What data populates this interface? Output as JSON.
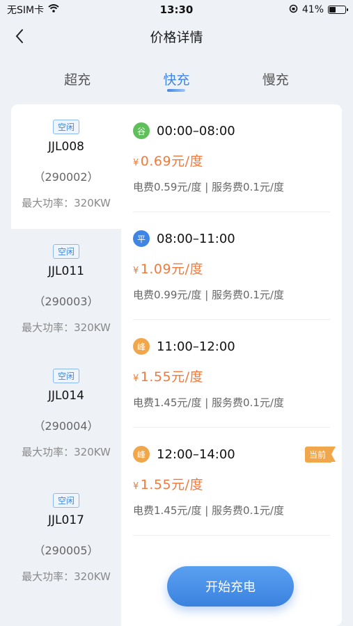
{
  "status_bar": {
    "carrier": "无SIM卡",
    "time": "13:30",
    "battery": "41%",
    "battery_level": 0.41
  },
  "nav": {
    "title": "价格详情"
  },
  "tabs": [
    {
      "label": "超充",
      "active": false
    },
    {
      "label": "快充",
      "active": true
    },
    {
      "label": "慢充",
      "active": false
    }
  ],
  "piles": [
    {
      "badge": "空闲",
      "name": "JJL008",
      "code": "（290002）",
      "power": "最大功率：320KW"
    },
    {
      "badge": "空闲",
      "name": "JJL011",
      "code": "（290003）",
      "power": "最大功率：320KW"
    },
    {
      "badge": "空闲",
      "name": "JJL014",
      "code": "（290004）",
      "power": "最大功率：320KW"
    },
    {
      "badge": "空闲",
      "name": "JJL017",
      "code": "（290005）",
      "power": "最大功率：320KW"
    }
  ],
  "periods": [
    {
      "tag": "谷",
      "tag_color": "#5fbf5a",
      "time": "00:00–08:00",
      "currency": "¥",
      "price": "0.69元/度",
      "detail": "电费0.59元/度 | 服务费0.1元/度"
    },
    {
      "tag": "平",
      "tag_color": "#3f86e4",
      "time": "08:00–11:00",
      "currency": "¥",
      "price": "1.09元/度",
      "detail": "电费0.99元/度 | 服务费0.1元/度"
    },
    {
      "tag": "峰",
      "tag_color": "#f0a64a",
      "time": "11:00–12:00",
      "currency": "¥",
      "price": "1.55元/度",
      "detail": "电费1.45元/度 | 服务费0.1元/度"
    },
    {
      "tag": "峰",
      "tag_color": "#f0a64a",
      "time": "12:00–14:00",
      "currency": "¥",
      "price": "1.55元/度",
      "detail": "电费1.45元/度 | 服务费0.1元/度",
      "current": "当前"
    }
  ],
  "start_button": "开始充电"
}
